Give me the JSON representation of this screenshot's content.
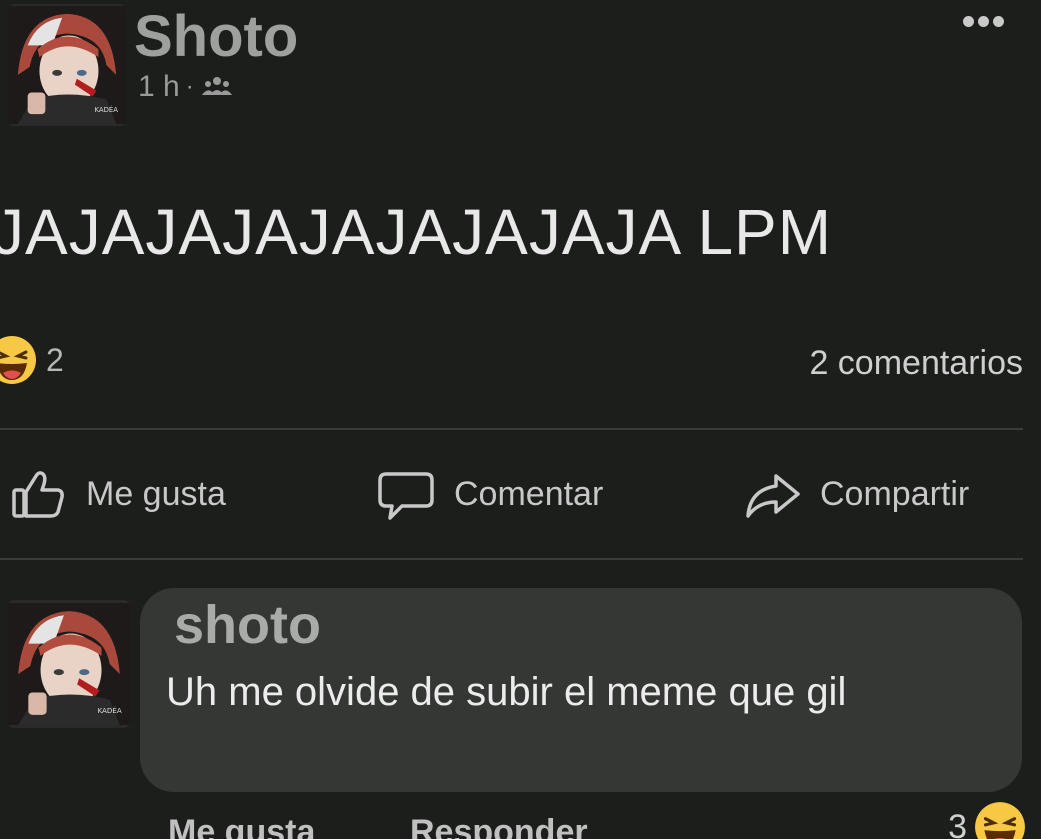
{
  "post": {
    "author": "Shoto",
    "time": "1 h",
    "separator": "·",
    "audience_icon": "group-icon",
    "text": "JAJAJAJAJAJAJAJAJA LPM",
    "reaction_icon": "haha-reaction-icon",
    "reaction_count": "2",
    "comment_count_label": "2 comentarios"
  },
  "actions": {
    "like_label": "Me gusta",
    "comment_label": "Comentar",
    "share_label": "Compartir"
  },
  "comment": {
    "author": "shoto",
    "text": "Uh me olvide de subir el meme que gil",
    "like_label": "Me gusta",
    "reply_label": "Responder",
    "reaction_count": "3",
    "reaction_icon": "haha-reaction-icon"
  },
  "colors": {
    "background": "#1c1e1c",
    "bubble": "#353735",
    "haha_yellow": "#f7c844"
  }
}
